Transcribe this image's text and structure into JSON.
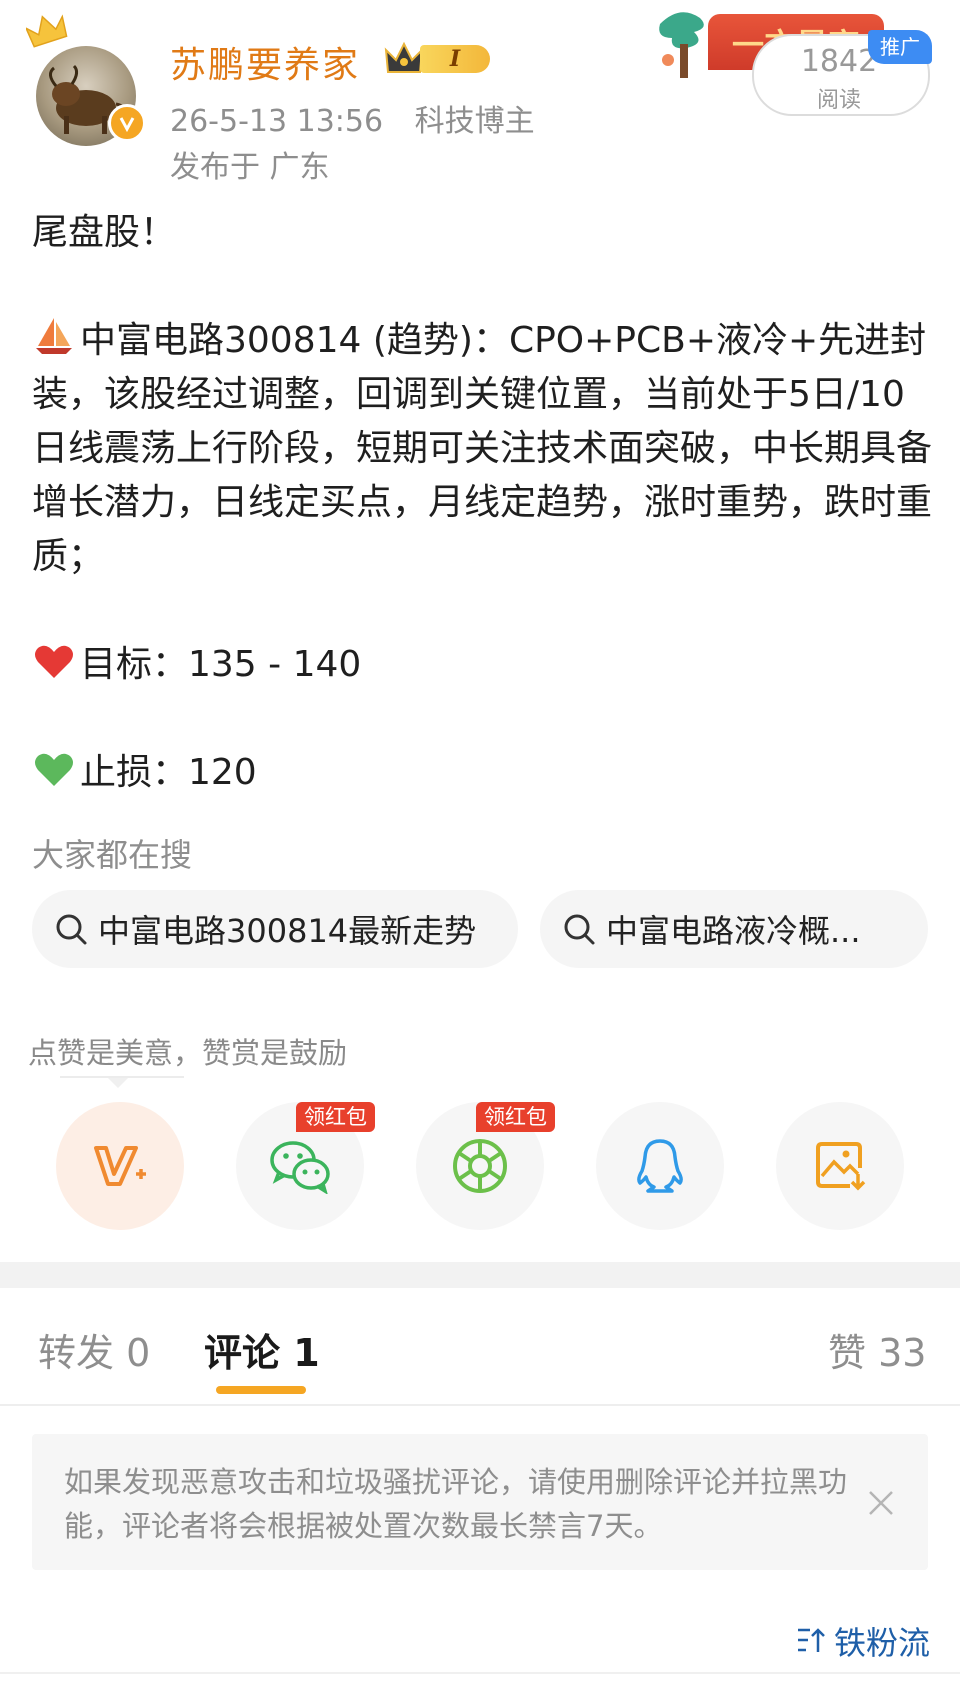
{
  "header": {
    "username": "苏鹏要养家",
    "vip_level": "I",
    "post_time": "26-5-13 13:56",
    "source": "科技博主",
    "location": "发布于 广东",
    "promo_banner_text": "一方景宇",
    "ad_tag": "推广",
    "read_count": "1842",
    "read_label": "阅读"
  },
  "post": {
    "line1": "尾盘股！",
    "stock_paragraph": "中富电路300814 (趋势)：CPO+PCB+液冷+先进封装，该股经过调整，回调到关键位置，当前处于5日/10日线震荡上行阶段，短期可关注技术面突破，中长期具备增长潜力，日线定买点，月线定趋势，涨时重势，跌时重质；",
    "target": "目标：135 - 140",
    "stoploss": "止损：120"
  },
  "trending": {
    "title": "大家都在搜",
    "chips": [
      "中富电路300814最新走势",
      "中富电路液冷概..."
    ]
  },
  "reward": {
    "hint": "点赞是美意，赞赏是鼓励",
    "red_packet_label": "领红包"
  },
  "tabs": {
    "repost": "转发 0",
    "comment": "评论 1",
    "like": "赞 33"
  },
  "notice": {
    "text": "如果发现恶意攻击和垃圾骚扰评论，请使用删除评论并拉黑功能，评论者将会根据被处置次数最长禁言7天。"
  },
  "sort": {
    "label": "铁粉流"
  },
  "colors": {
    "username": "#e07a16",
    "accent_underline": "#f5a623",
    "red_tag": "#e8402c",
    "ad_blue": "#3d8cf3",
    "sort_link": "#1f5fa8"
  },
  "icons": [
    "crown-icon",
    "verified-icon",
    "sailboat-icon",
    "red-heart-icon",
    "green-heart-icon",
    "search-icon",
    "v-plus-icon",
    "wechat-icon",
    "moments-icon",
    "qq-icon",
    "save-image-icon",
    "close-icon",
    "sort-icon"
  ]
}
